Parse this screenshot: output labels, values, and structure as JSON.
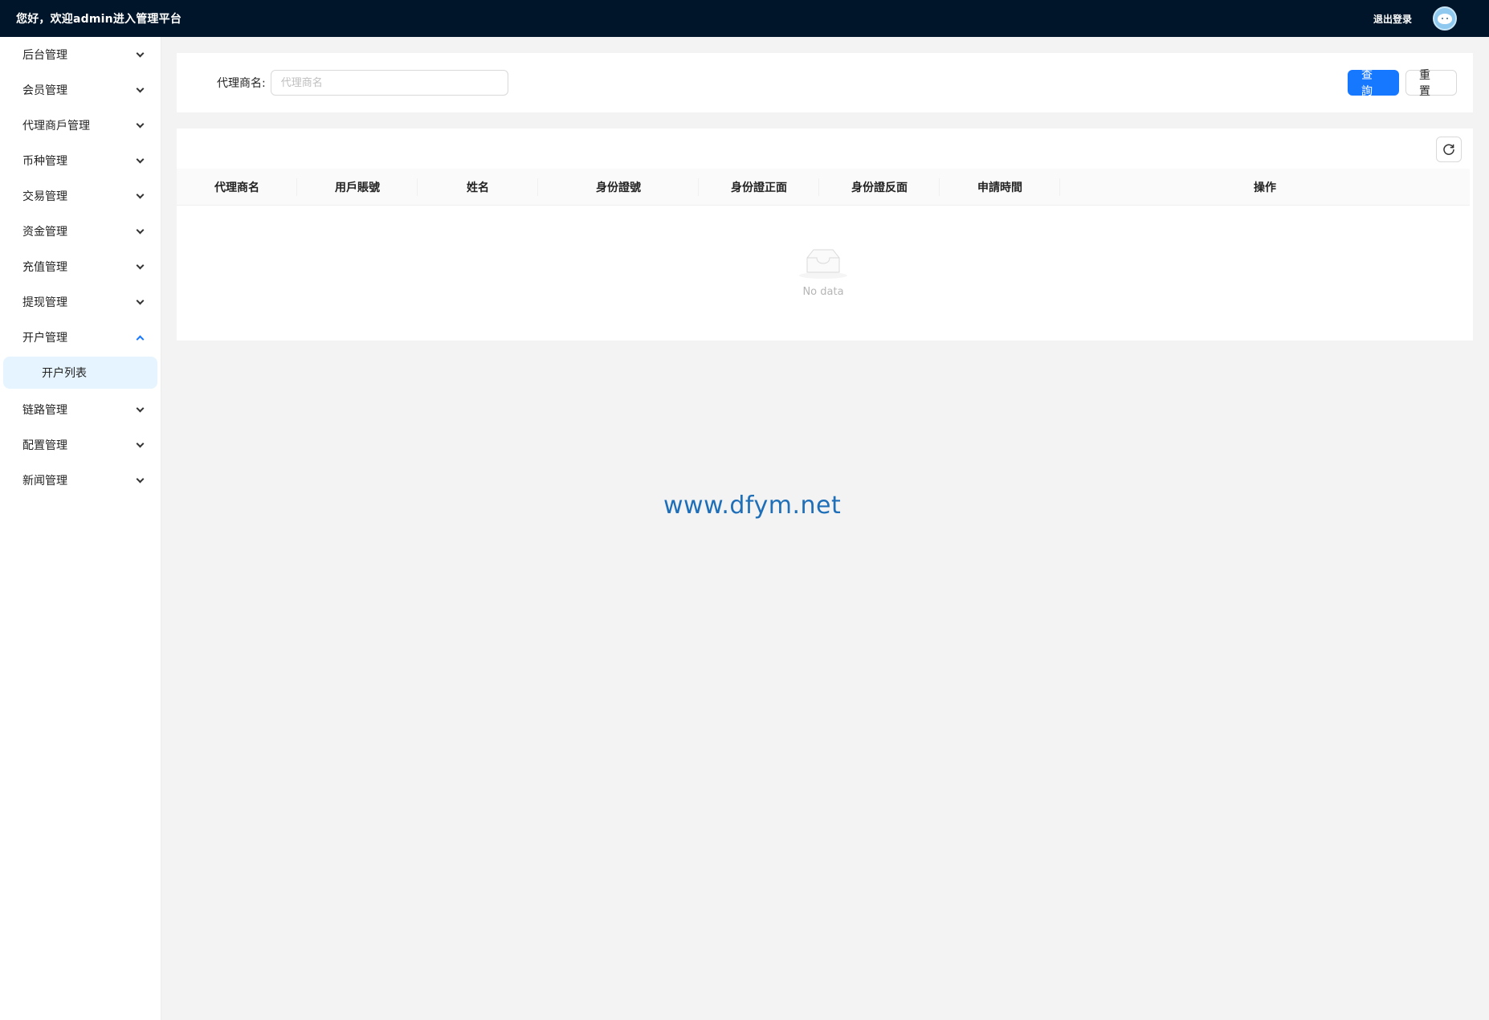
{
  "header": {
    "welcome": "您好，欢迎admin进入管理平台",
    "logout": "退出登录"
  },
  "sidebar": {
    "items": [
      {
        "label": "后台管理"
      },
      {
        "label": "会员管理"
      },
      {
        "label": "代理商戶管理"
      },
      {
        "label": "币种管理"
      },
      {
        "label": "交易管理"
      },
      {
        "label": "资金管理"
      },
      {
        "label": "充值管理"
      },
      {
        "label": "提现管理"
      },
      {
        "label": "开户管理",
        "open": true,
        "children": [
          {
            "label": "开户列表",
            "selected": true
          }
        ]
      },
      {
        "label": "链路管理"
      },
      {
        "label": "配置管理"
      },
      {
        "label": "新闻管理"
      }
    ]
  },
  "search": {
    "label": "代理商名:",
    "placeholder": "代理商名",
    "value": "",
    "query_label": "查詢",
    "reset_label": "重置"
  },
  "table": {
    "columns": [
      "代理商名",
      "用戶賬號",
      "姓名",
      "身份證號",
      "身份證正面",
      "身份證反面",
      "申請時間",
      "操作"
    ],
    "rows": [],
    "empty_text": "No data"
  },
  "watermark": "www.dfym.net",
  "colors": {
    "header_bg": "#001529",
    "primary": "#1677ff",
    "selected_bg": "#e6f4ff"
  }
}
